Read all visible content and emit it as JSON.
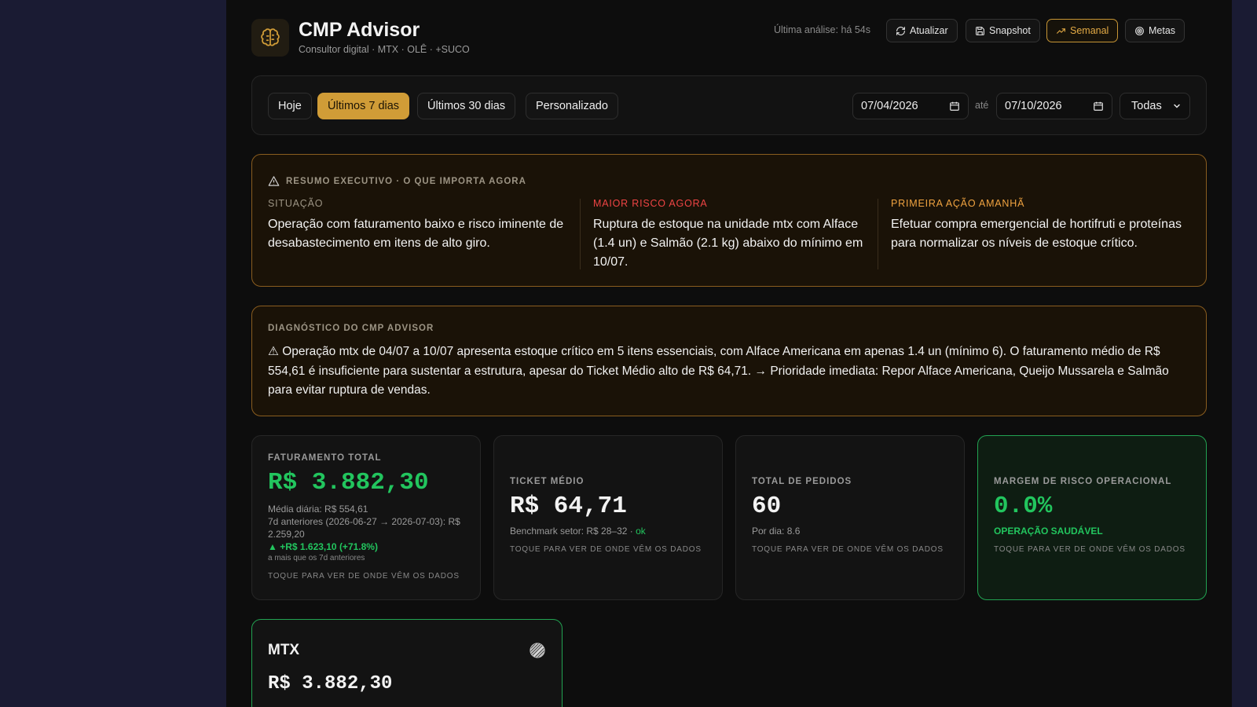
{
  "header": {
    "title": "CMP Advisor",
    "subtitle": "Consultor digital · MTX · OLÊ · +SUCO",
    "last_analysis": "Última análise: há 54s",
    "buttons": {
      "refresh": "Atualizar",
      "snapshot": "Snapshot",
      "weekly": "Semanal",
      "goals": "Metas"
    },
    "accent_color": "#d09c37"
  },
  "filters": {
    "today": "Hoje",
    "last7": "Últimos 7 dias",
    "last30": "Últimos 30 dias",
    "custom": "Personalizado",
    "active": "Últimos 7 dias",
    "date_from": "07/04/2026",
    "date_sep": "até",
    "date_to": "07/10/2026",
    "unit_select": "Todas"
  },
  "executive_summary": {
    "heading": "RESUMO EXECUTIVO · O QUE IMPORTA AGORA",
    "situation_label": "SITUAÇÃO",
    "situation_text": "Operação com faturamento baixo e risco iminente de desabastecimento em itens de alto giro.",
    "risk_label": "MAIOR RISCO AGORA",
    "risk_text": "Ruptura de estoque na unidade mtx com Alface (1.4 un) e Salmão (2.1 kg) abaixo do mínimo em 10/07.",
    "action_label": "PRIMEIRA AÇÃO AMANHÃ",
    "action_text": "Efetuar compra emergencial de hortifruti e proteínas para normalizar os níveis de estoque crítico."
  },
  "diagnostic": {
    "heading": "DIAGNÓSTICO DO CMP ADVISOR",
    "text": "⚠ Operação mtx de 04/07 a 10/07 apresenta estoque crítico em 5 itens essenciais, com Alface Americana em apenas 1.4 un (mínimo 6). O faturamento médio de R$ 554,61 é insuficiente para sustentar a estrutura, apesar do Ticket Médio alto de R$ 64,71. → Prioridade imediata: Repor Alface Americana, Queijo Mussarela e Salmão para evitar ruptura de vendas."
  },
  "kpis": {
    "revenue": {
      "label": "FATURAMENTO TOTAL",
      "value": "R$ 3.882,30",
      "daily_avg": "Média diária: R$ 554,61",
      "previous": "7d anteriores (2026-06-27 → 2026-07-03): R$ 2.259,20",
      "delta": "▲ +R$ 1.623,10 (+71.8%)",
      "delta_note": "a mais que os 7d anteriores",
      "tap": "TOQUE PARA VER DE ONDE VÊM OS DADOS"
    },
    "ticket": {
      "label": "TICKET MÉDIO",
      "value": "R$ 64,71",
      "benchmark": "Benchmark setor: R$ 28–32 ·",
      "benchmark_status": "ok",
      "tap": "TOQUE PARA VER DE ONDE VÊM OS DADOS"
    },
    "orders": {
      "label": "TOTAL DE PEDIDOS",
      "value": "60",
      "per_day": "Por dia: 8.6",
      "tap": "TOQUE PARA VER DE ONDE VÊM OS DADOS"
    },
    "risk": {
      "label": "MARGEM DE RISCO OPERACIONAL",
      "value": "0.0%",
      "status": "OPERAÇÃO SAUDÁVEL",
      "tap": "TOQUE PARA VER DE ONDE VÊM OS DADOS"
    }
  },
  "units": [
    {
      "name": "MTX",
      "value": "R$ 3.882,30"
    }
  ],
  "colors": {
    "green": "#22c55e",
    "risk_red": "#ef4444",
    "action_orange": "#f0a340"
  }
}
